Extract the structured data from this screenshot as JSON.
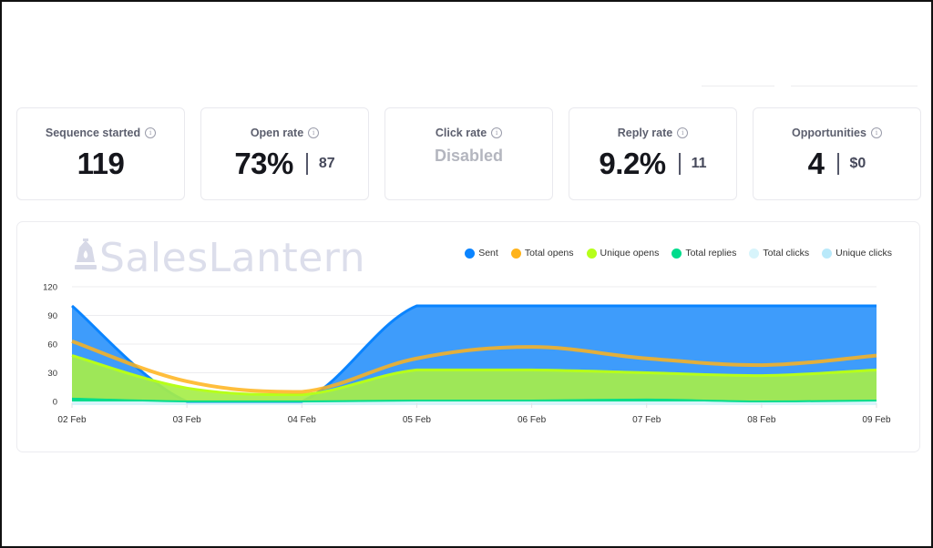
{
  "filters": {
    "items": [
      {
        "name": "date-filter"
      },
      {
        "name": "campaign-filter"
      }
    ]
  },
  "stats": [
    {
      "id": "sequence-started",
      "label": "Sequence started",
      "value": "119",
      "sub": null,
      "disabled": false
    },
    {
      "id": "open-rate",
      "label": "Open rate",
      "value": "73%",
      "sub": "87",
      "disabled": false
    },
    {
      "id": "click-rate",
      "label": "Click rate",
      "value": "Disabled",
      "sub": null,
      "disabled": true
    },
    {
      "id": "reply-rate",
      "label": "Reply rate",
      "value": "9.2%",
      "sub": "11",
      "disabled": false
    },
    {
      "id": "opportunities",
      "label": "Opportunities",
      "value": "4",
      "sub": "$0",
      "disabled": false
    }
  ],
  "info_icon_glyph": "i",
  "brand": {
    "name": "SalesLantern",
    "icon": "lantern-icon"
  },
  "chart_data": {
    "type": "area",
    "title": "",
    "xlabel": "",
    "ylabel": "",
    "ylim": [
      0,
      120
    ],
    "yticks": [
      0,
      30,
      60,
      90,
      120
    ],
    "grid": true,
    "legend_position": "top-right",
    "categories": [
      "02 Feb",
      "03 Feb",
      "04 Feb",
      "05 Feb",
      "06 Feb",
      "07 Feb",
      "08 Feb",
      "09 Feb"
    ],
    "series": [
      {
        "name": "Sent",
        "color": "#0a84ff",
        "fill": "#3e9cfb",
        "style": "area",
        "values": [
          100,
          0,
          0,
          100,
          100,
          100,
          100,
          100
        ]
      },
      {
        "name": "Total opens",
        "color": "#ffb31a",
        "fill": null,
        "style": "line",
        "values": [
          63,
          21,
          10,
          45,
          57,
          45,
          38,
          48
        ]
      },
      {
        "name": "Unique opens",
        "color": "#b6ff1a",
        "fill": "#a6ee4a",
        "style": "area",
        "values": [
          48,
          14,
          7,
          33,
          33,
          30,
          27,
          33
        ]
      },
      {
        "name": "Total replies",
        "color": "#00dc8c",
        "fill": "#00dc8c",
        "style": "area",
        "values": [
          3,
          0,
          0,
          1,
          1,
          2,
          0,
          1
        ]
      },
      {
        "name": "Total clicks",
        "color": "#d7f4fb",
        "fill": "#d7f4fb",
        "style": "area",
        "values": [
          0,
          0,
          0,
          0,
          0,
          0,
          0,
          0
        ]
      },
      {
        "name": "Unique clicks",
        "color": "#b9e9fa",
        "fill": "#b9e9fa",
        "style": "area",
        "values": [
          0,
          0,
          0,
          0,
          0,
          0,
          0,
          0
        ]
      }
    ]
  }
}
